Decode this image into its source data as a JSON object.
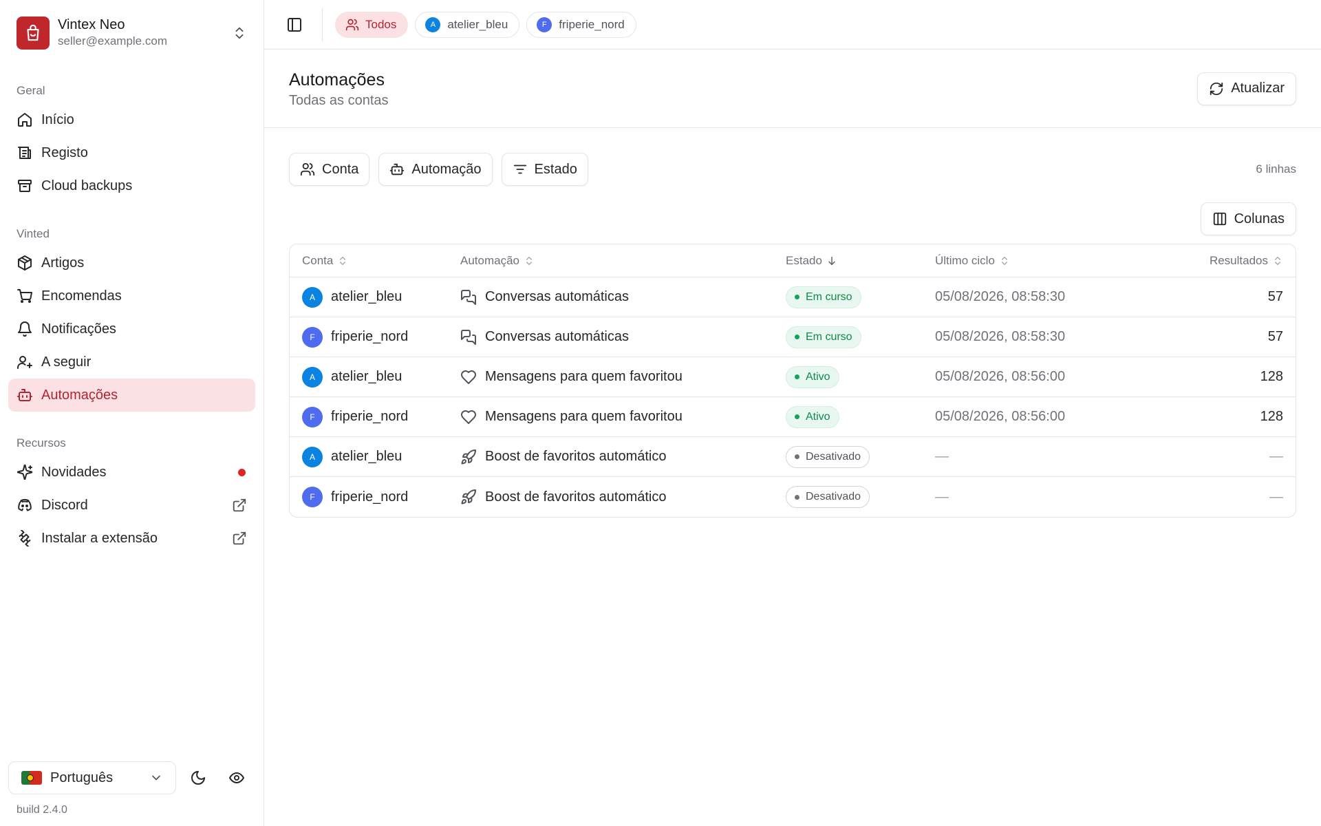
{
  "user": {
    "name": "Vintex Neo",
    "email": "seller@example.com"
  },
  "sidebar": {
    "groups": [
      {
        "label": "Geral",
        "items": [
          {
            "label": "Início",
            "icon": "home-icon"
          },
          {
            "label": "Registo",
            "icon": "log-icon"
          },
          {
            "label": "Cloud backups",
            "icon": "archive-icon"
          }
        ]
      },
      {
        "label": "Vinted",
        "items": [
          {
            "label": "Artigos",
            "icon": "package-icon"
          },
          {
            "label": "Encomendas",
            "icon": "cart-icon"
          },
          {
            "label": "Notificações",
            "icon": "bell-icon"
          },
          {
            "label": "A seguir",
            "icon": "user-plus-icon"
          },
          {
            "label": "Automações",
            "icon": "bot-icon",
            "active": true
          }
        ]
      },
      {
        "label": "Recursos",
        "items": [
          {
            "label": "Novidades",
            "icon": "sparkles-icon"
          },
          {
            "label": "Discord",
            "icon": "discord-icon"
          },
          {
            "label": "Instalar a extensão",
            "icon": "puzzle-icon"
          }
        ]
      }
    ],
    "language": "Português",
    "build": "build 2.4.0"
  },
  "topbar": {
    "chips": [
      {
        "label": "Todos",
        "active": true
      },
      {
        "label": "atelier_bleu",
        "initial": "A"
      },
      {
        "label": "friperie_nord",
        "initial": "F"
      }
    ]
  },
  "page": {
    "title": "Automações",
    "subtitle": "Todas as contas",
    "refresh_label": "Atualizar"
  },
  "filters": {
    "account": "Conta",
    "automation": "Automação",
    "status": "Estado",
    "row_count": "6 linhas",
    "columns": "Colunas"
  },
  "table": {
    "headers": {
      "account": "Conta",
      "automation": "Automação",
      "status": "Estado",
      "last_cycle": "Último ciclo",
      "results": "Resultados"
    },
    "rows": [
      {
        "initial": "A",
        "account": "atelier_bleu",
        "automation": "Conversas automáticas",
        "status": "Em curso",
        "last_cycle": "05/08/2026, 08:58:30",
        "results": "57"
      },
      {
        "initial": "F",
        "account": "friperie_nord",
        "automation": "Conversas automáticas",
        "status": "Em curso",
        "last_cycle": "05/08/2026, 08:58:30",
        "results": "57"
      },
      {
        "initial": "A",
        "account": "atelier_bleu",
        "automation": "Mensagens para quem favoritou",
        "status": "Ativo",
        "last_cycle": "05/08/2026, 08:56:00",
        "results": "128"
      },
      {
        "initial": "F",
        "account": "friperie_nord",
        "automation": "Mensagens para quem favoritou",
        "status": "Ativo",
        "last_cycle": "05/08/2026, 08:56:00",
        "results": "128"
      },
      {
        "initial": "A",
        "account": "atelier_bleu",
        "automation": "Boost de favoritos automático",
        "status": "Desativado",
        "last_cycle": "—",
        "results": "—"
      },
      {
        "initial": "F",
        "account": "friperie_nord",
        "automation": "Boost de favoritos automático",
        "status": "Desativado",
        "last_cycle": "—",
        "results": "—"
      }
    ]
  },
  "colors": {
    "brand": "#c0272d",
    "accent_bg": "#fbe1e3",
    "accent_text": "#b42332",
    "status_active": "#0f8a4a",
    "avatar_a": "#0a84e0",
    "avatar_f": "#4f6cf0"
  }
}
